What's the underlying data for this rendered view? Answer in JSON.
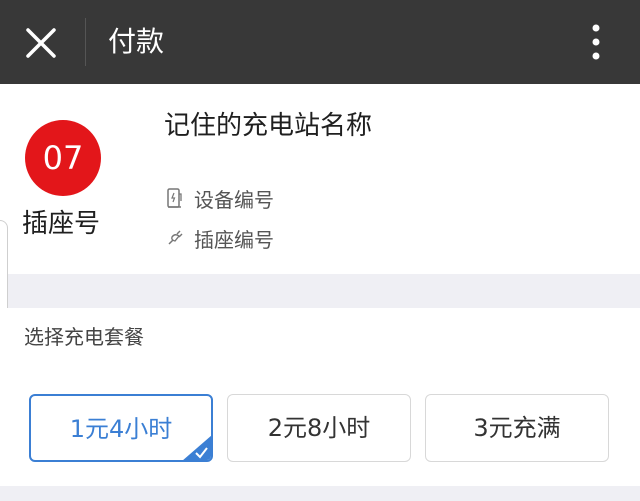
{
  "topbar": {
    "title": "付款",
    "close_icon": "close-icon",
    "more_icon": "more-vertical-icon",
    "background": "#383838"
  },
  "socket": {
    "number": "07",
    "label": "插座号",
    "badge_color": "#e3161a"
  },
  "station": {
    "name": "记住的充电站名称",
    "device_label": "设备编号",
    "device_icon": "charging-pile-icon",
    "socket_label": "插座编号",
    "socket_icon": "plug-icon"
  },
  "plans": {
    "heading": "选择充电套餐",
    "options": [
      {
        "label": "1元4小时",
        "selected": true
      },
      {
        "label": "2元8小时",
        "selected": false
      },
      {
        "label": "3元充满",
        "selected": false
      }
    ],
    "accent": "#3b7fd4"
  }
}
